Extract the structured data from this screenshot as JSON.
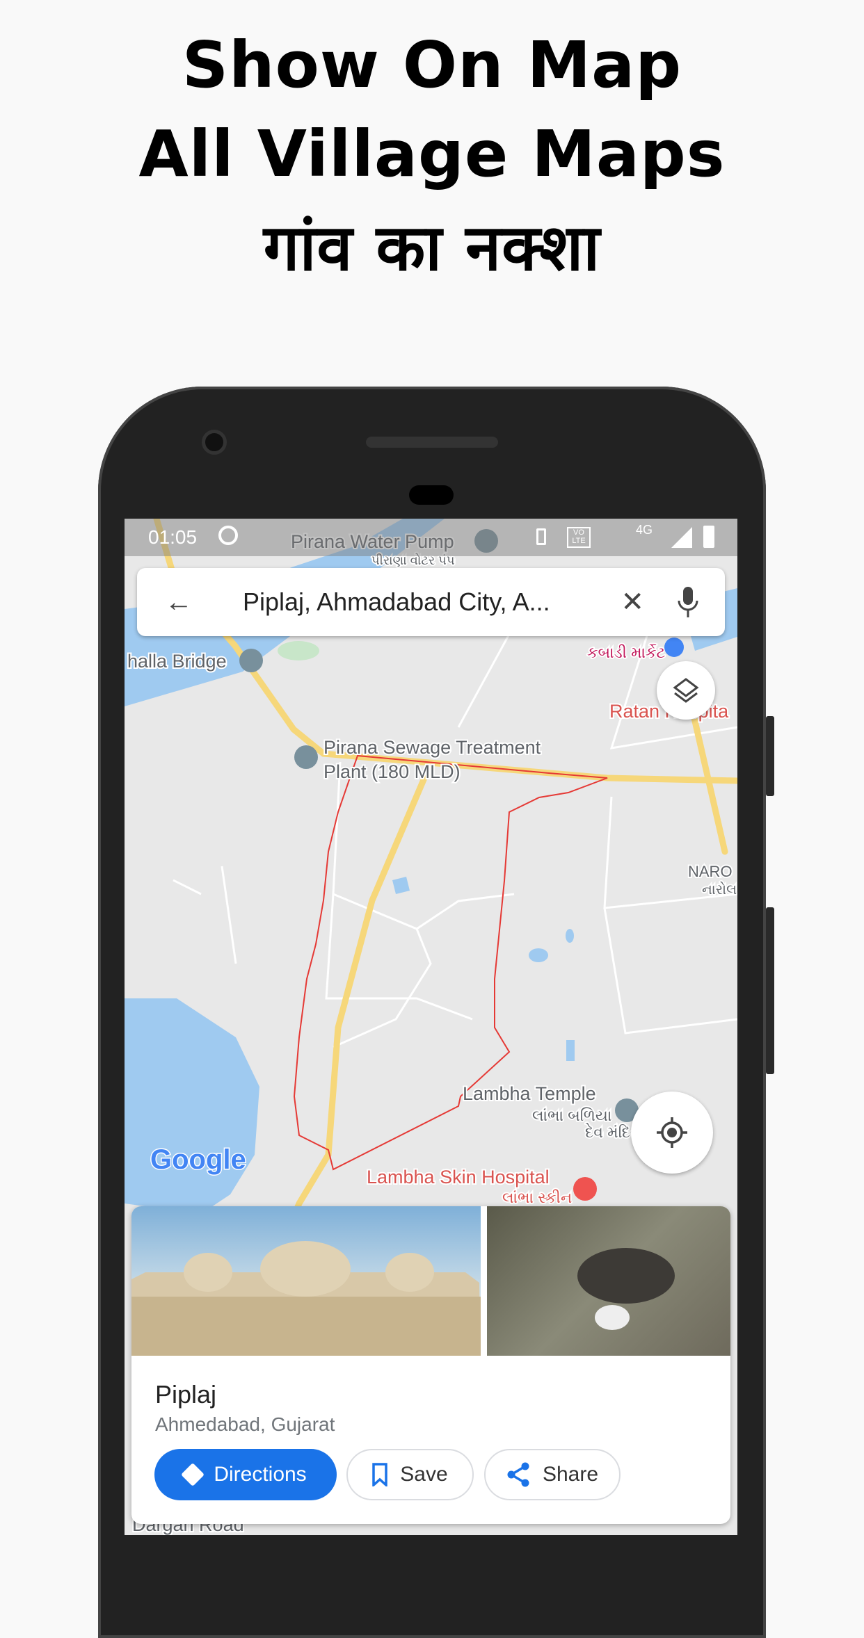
{
  "headline": {
    "line1": "Show On Map",
    "line2": "All Village Maps",
    "line3": "गांव का नक्शा"
  },
  "status_bar": {
    "time": "01:05",
    "network": "4G",
    "volte": "VO LTE",
    "icons": [
      "data-saver-icon",
      "location-icon",
      "vibrate-icon",
      "volte-icon",
      "hotspot-icon",
      "signal-icon",
      "battery-charging-icon"
    ]
  },
  "search": {
    "value": "Piplaj, Ahmadabad City, A...",
    "back_icon": "arrow-left-icon",
    "clear_icon": "close-icon",
    "mic_icon": "mic-icon"
  },
  "map": {
    "labels": {
      "water_pump": "Pirana Water Pump",
      "water_pump_gu": "પીરાણા વોટર પંપ",
      "bridge": "halla Bridge",
      "kabadi_gu": "કબાડી માર્કેટ",
      "ratan": "Ratan Hospita",
      "sewage1": "Pirana Sewage Treatment",
      "sewage2": "Plant (180 MLD)",
      "naro": "NARO",
      "naro_gu": "નારોલ",
      "temple": "Lambha Temple",
      "temple_gu1": "લાંભા બળિયા",
      "temple_gu2": "દેવ મંદિર",
      "hospital": "Lambha Skin Hospital",
      "hospital_gu": "લાંભા સ્કીન",
      "dargah": "Dargah Road",
      "google": "Google"
    },
    "colors": {
      "land": "#e8e8e8",
      "water": "#9fcaf0",
      "road": "#f6d77a",
      "boundary": "#e53935"
    }
  },
  "place_card": {
    "title": "Piplaj",
    "subtitle": "Ahmedabad, Gujarat",
    "buttons": {
      "directions": "Directions",
      "save": "Save",
      "share": "Share"
    },
    "accent": "#1a73e8"
  }
}
